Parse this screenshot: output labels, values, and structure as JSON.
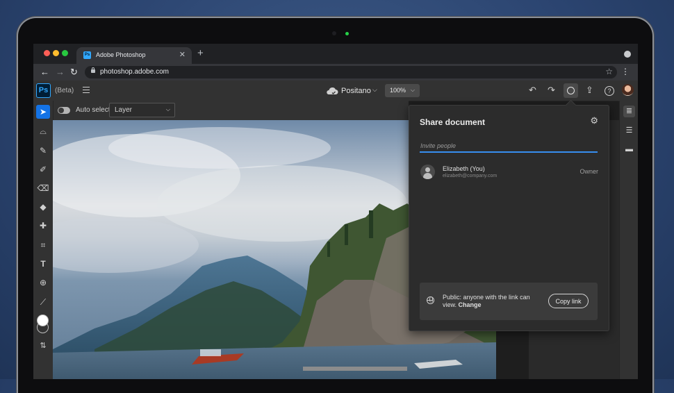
{
  "browser": {
    "tab_title": "Adobe Photoshop",
    "tab_close": "✕",
    "new_tab": "+",
    "url": "photoshop.adobe.com",
    "back": "←",
    "forward": "→",
    "reload": "↻",
    "star": "☆",
    "menu": "⋮",
    "traffic_colors": [
      "#ff5f57",
      "#febc2e",
      "#28c840"
    ]
  },
  "header": {
    "logo": "Ps",
    "beta": "(Beta)",
    "doc_name": "Positano",
    "doc_chevron": "⌵",
    "zoom": "100%",
    "zoom_chevron": "⌵",
    "undo": "↶",
    "redo": "↷",
    "export": "⇪",
    "help": "?"
  },
  "options": {
    "auto_select_label": "Auto select",
    "layer_select": "Layer",
    "layer_chevron": "⌵"
  },
  "tools": [
    {
      "name": "move-tool",
      "icon": "➤"
    },
    {
      "name": "lasso-tool",
      "icon": "⌓"
    },
    {
      "name": "quick-select-tool",
      "icon": "✎"
    },
    {
      "name": "brush-tool",
      "icon": "✐"
    },
    {
      "name": "eraser-tool",
      "icon": "⌫"
    },
    {
      "name": "paint-bucket-tool",
      "icon": "◆"
    },
    {
      "name": "healing-tool",
      "icon": "✚"
    },
    {
      "name": "crop-tool",
      "icon": "⌗"
    },
    {
      "name": "type-tool",
      "icon": "T"
    },
    {
      "name": "clone-stamp-tool",
      "icon": "⊕"
    },
    {
      "name": "eyedropper-tool",
      "icon": "⟋"
    }
  ],
  "swap_icon": "⇅",
  "dock": {
    "layers": "≣",
    "adjust": "☰",
    "comments": "▬"
  },
  "share": {
    "title": "Share document",
    "gear": "⚙",
    "invite_placeholder": "Invite people",
    "person_name": "Elizabeth (You)",
    "person_email": "elizabeth@company.com",
    "person_role": "Owner",
    "public_text": "Public: anyone with the link can view.",
    "change_label": "Change",
    "copy_link": "Copy link"
  },
  "colors": {
    "accent": "#1473e6",
    "ps_blue": "#31a8ff",
    "led": "#26d148"
  }
}
